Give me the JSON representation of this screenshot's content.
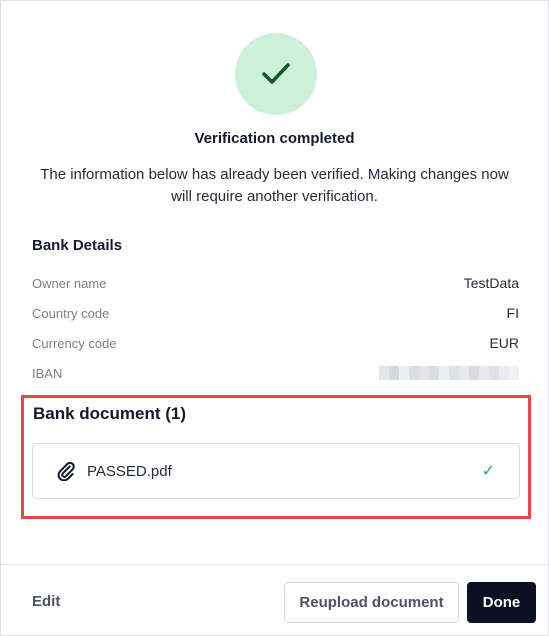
{
  "header": {
    "icon": "checkmark-icon",
    "title": "Verification completed",
    "subtitle": "The information below has already been verified. Making changes now will require another verification."
  },
  "bank_details": {
    "title": "Bank Details",
    "rows": [
      {
        "label": "Owner name",
        "value": "TestData"
      },
      {
        "label": "Country code",
        "value": "FI"
      },
      {
        "label": "Currency code",
        "value": "EUR"
      },
      {
        "label": "IBAN",
        "value": ""
      }
    ]
  },
  "bank_document": {
    "title": "Bank document (1)",
    "file": {
      "icon": "paperclip-icon",
      "name": "PASSED.pdf",
      "status_icon": "checkmark-icon"
    }
  },
  "footer": {
    "edit_label": "Edit",
    "reupload_label": "Reupload document",
    "done_label": "Done"
  },
  "colors": {
    "success_bg": "#cdf0d8",
    "success_check": "#12582f",
    "file_ok": "#1faa59",
    "highlight": "#e8474a",
    "primary": "#0b1024"
  }
}
